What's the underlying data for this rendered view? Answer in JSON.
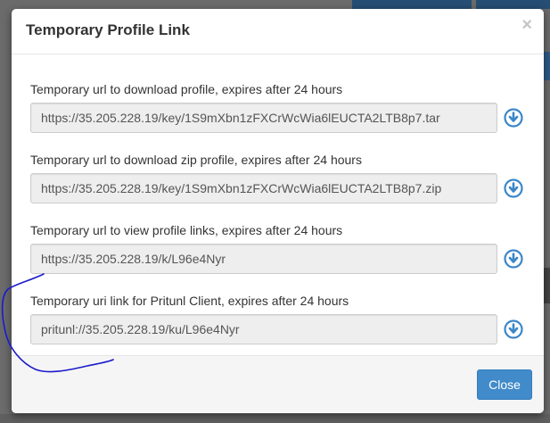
{
  "modal": {
    "title": "Temporary Profile Link",
    "close_symbol": "×",
    "fields": [
      {
        "label": "Temporary url to download profile, expires after 24 hours",
        "value": "https://35.205.228.19/key/1S9mXbn1zFXCrWcWia6lEUCTA2LTB8p7.tar",
        "icon": "download-circle-icon"
      },
      {
        "label": "Temporary url to download zip profile, expires after 24 hours",
        "value": "https://35.205.228.19/key/1S9mXbn1zFXCrWcWia6lEUCTA2LTB8p7.zip",
        "icon": "download-circle-icon"
      },
      {
        "label": "Temporary url to view profile links, expires after 24 hours",
        "value": "https://35.205.228.19/k/L96e4Nyr",
        "icon": "download-circle-icon"
      },
      {
        "label": "Temporary uri link for Pritunl Client, expires after 24 hours",
        "value": "pritunl://35.205.228.19/ku/L96e4Nyr",
        "icon": "download-circle-icon"
      }
    ],
    "footer": {
      "close_label": "Close"
    }
  },
  "colors": {
    "primary": "#428bca",
    "icon": "#3a87c8",
    "annotation": "#1a1acc"
  }
}
